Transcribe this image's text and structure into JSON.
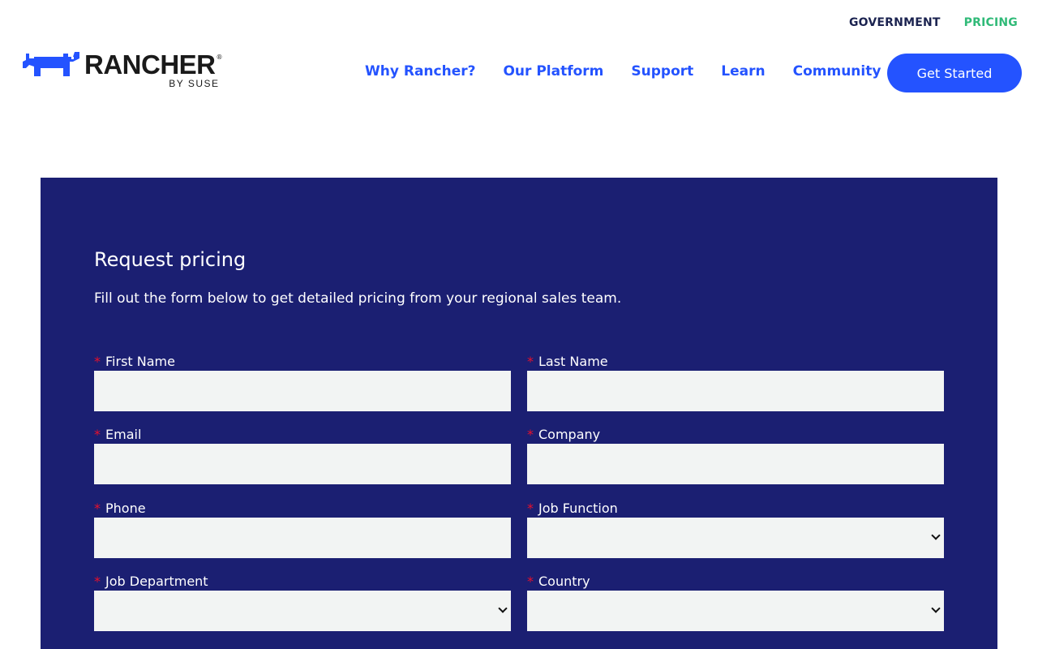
{
  "topbar": {
    "government": "GOVERNMENT",
    "pricing": "PRICING"
  },
  "logo": {
    "wordmark": "RANCHER",
    "registered": "®",
    "sub": "BY SUSE"
  },
  "nav": {
    "items": [
      "Why Rancher?",
      "Our Platform",
      "Support",
      "Learn",
      "Community"
    ],
    "cta": "Get Started"
  },
  "form": {
    "title": "Request pricing",
    "subtitle": "Fill out the form below to get detailed pricing from your regional sales team.",
    "required_mark": "*",
    "fields": {
      "first_name": {
        "label": "First Name",
        "value": ""
      },
      "last_name": {
        "label": "Last Name",
        "value": ""
      },
      "email": {
        "label": "Email",
        "value": ""
      },
      "company": {
        "label": "Company",
        "value": ""
      },
      "phone": {
        "label": "Phone",
        "value": ""
      },
      "job_function": {
        "label": "Job Function",
        "selected": ""
      },
      "job_department": {
        "label": "Job Department",
        "selected": ""
      },
      "country": {
        "label": "Country",
        "selected": ""
      }
    }
  },
  "colors": {
    "brand_blue": "#2453ff",
    "panel_navy": "#1b1f72",
    "pricing_green": "#30ba78",
    "required_red": "#e8102b",
    "input_bg": "#f2f4f3"
  },
  "icons": {
    "logo": "rancher-bull-logo",
    "select": "chevron-down-icon"
  }
}
